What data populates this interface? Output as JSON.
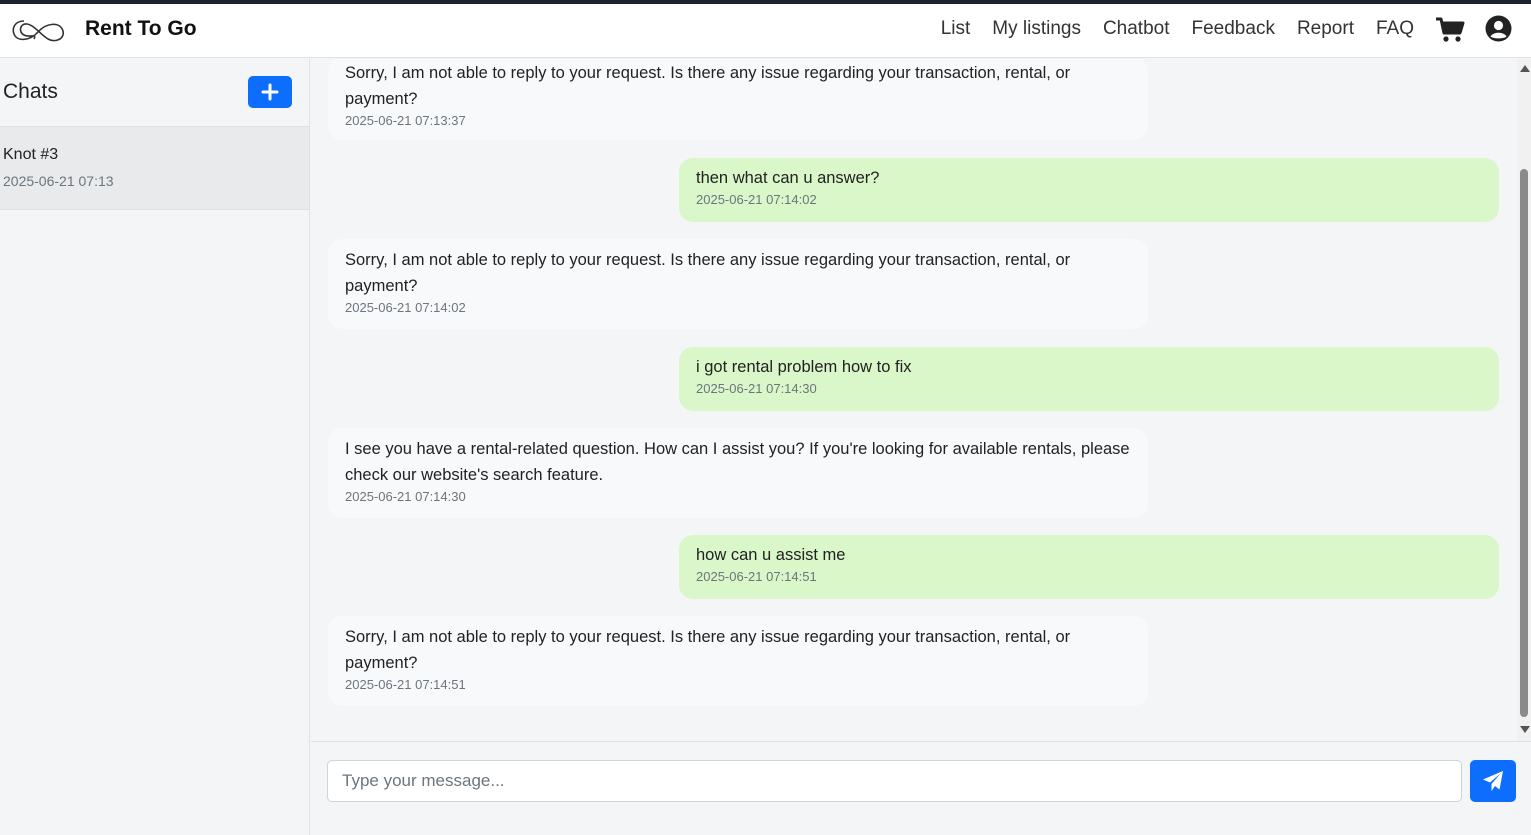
{
  "app": {
    "brand": "Rent To Go",
    "logo_icon": "infinity-knot-logo"
  },
  "nav": {
    "links": [
      "List",
      "My listings",
      "Chatbot",
      "Feedback",
      "Report",
      "FAQ"
    ],
    "cart_icon": "cart-icon",
    "user_icon": "user-circle-icon"
  },
  "sidebar": {
    "title": "Chats",
    "new_chat_icon": "plus-icon",
    "items": [
      {
        "name": "Knot #3",
        "time": "2025-06-21 07:13"
      }
    ]
  },
  "messages": [
    {
      "role": "bot",
      "text": "Sorry, I am not able to reply to your request. Is there any issue regarding your transaction, rental, or payment?",
      "time": "2025-06-21 07:13:37"
    },
    {
      "role": "user",
      "text": "then what can u answer?",
      "time": "2025-06-21 07:14:02"
    },
    {
      "role": "bot",
      "text": "Sorry, I am not able to reply to your request. Is there any issue regarding your transaction, rental, or payment?",
      "time": "2025-06-21 07:14:02"
    },
    {
      "role": "user",
      "text": "i got rental problem how to fix",
      "time": "2025-06-21 07:14:30"
    },
    {
      "role": "bot",
      "text": "I see you have a rental-related question. How can I assist you? If you're looking for available rentals, please check our website's search feature.",
      "time": "2025-06-21 07:14:30"
    },
    {
      "role": "user",
      "text": "how can u assist me",
      "time": "2025-06-21 07:14:51"
    },
    {
      "role": "bot",
      "text": "Sorry, I am not able to reply to your request. Is there any issue regarding your transaction, rental, or payment?",
      "time": "2025-06-21 07:14:51"
    }
  ],
  "composer": {
    "placeholder": "Type your message...",
    "send_icon": "paper-plane-icon"
  },
  "colors": {
    "accent": "#0d6efd",
    "user_bubble": "#d9f7c9",
    "bot_bubble": "#f8f9fa"
  }
}
